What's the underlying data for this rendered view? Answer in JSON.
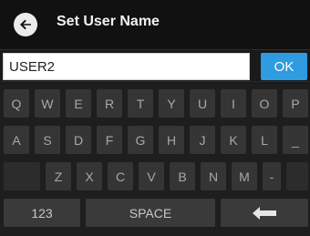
{
  "header": {
    "title": "Set User Name",
    "back_icon": "arrow-left-circle-icon"
  },
  "input": {
    "value": "USER2",
    "ok_label": "OK"
  },
  "keyboard": {
    "row1": [
      "Q",
      "W",
      "E",
      "R",
      "T",
      "Y",
      "U",
      "I",
      "O",
      "P"
    ],
    "row2": [
      "A",
      "S",
      "D",
      "F",
      "G",
      "H",
      "J",
      "K",
      "L",
      "_"
    ],
    "row3": [
      "Z",
      "X",
      "C",
      "V",
      "B",
      "N",
      "M",
      "-"
    ],
    "row4": {
      "numbers_label": "123",
      "space_label": "SPACE",
      "backspace_icon": "backspace-arrow-icon"
    }
  },
  "colors": {
    "accent": "#2f9be0",
    "header_bg": "#111111",
    "key_bg": "#353535"
  }
}
